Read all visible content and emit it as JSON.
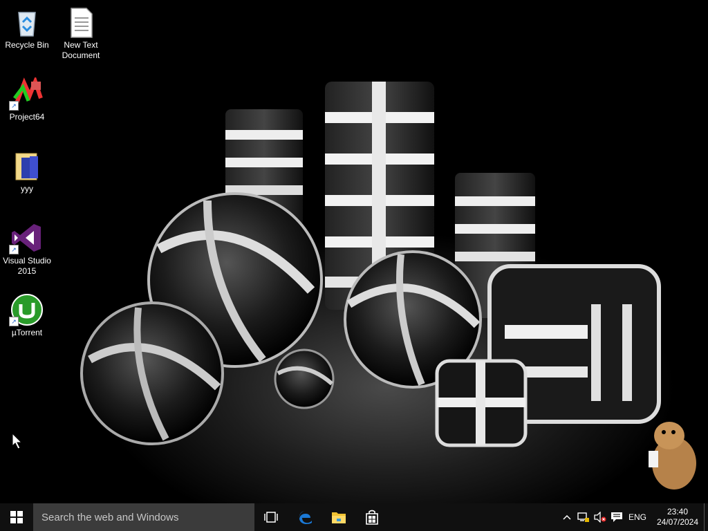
{
  "desktop": {
    "icons": [
      {
        "label": "Recycle Bin",
        "icon": "recycle-bin-icon"
      },
      {
        "label": "New Text Document",
        "icon": "text-document-icon"
      },
      {
        "label": "Project64",
        "icon": "project64-icon"
      },
      {
        "label": "yyy",
        "icon": "folder-icon"
      },
      {
        "label": "Visual Studio 2015",
        "icon": "visual-studio-icon"
      },
      {
        "label": "µTorrent",
        "icon": "utorrent-icon"
      }
    ]
  },
  "taskbar": {
    "search_placeholder": "Search the web and Windows",
    "pinned": [
      "task-view-icon",
      "edge-icon",
      "file-explorer-icon",
      "store-icon"
    ],
    "tray": {
      "language": "ENG",
      "time": "23:40",
      "date": "24/07/2024"
    }
  },
  "colors": {
    "taskbar": "#101010",
    "search_box": "#3b3b3b",
    "accent": "#1b79d6"
  }
}
